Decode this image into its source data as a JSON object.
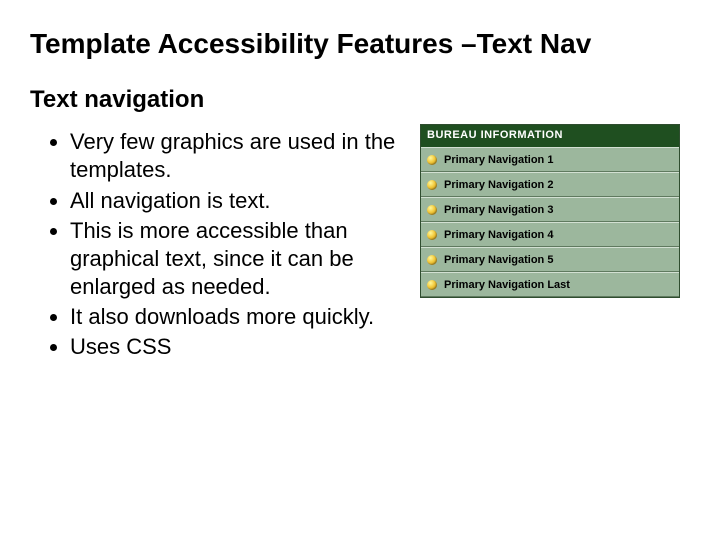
{
  "title": "Template Accessibility Features –Text Nav",
  "subheading": "Text navigation",
  "bullets": [
    "Very few graphics are used in the templates.",
    "All navigation is text.",
    "This is more accessible than graphical text, since it can be enlarged as needed.",
    "It also downloads more quickly.",
    "Uses CSS"
  ],
  "nav": {
    "header": "BUREAU INFORMATION",
    "items": [
      "Primary Navigation 1",
      "Primary Navigation 2",
      "Primary Navigation 3",
      "Primary Navigation 4",
      "Primary Navigation 5",
      "Primary Navigation Last"
    ]
  },
  "colors": {
    "nav_header_bg": "#1f4f20",
    "nav_item_bg": "#9cb79d",
    "bullet_dot": "#f2c83a"
  }
}
